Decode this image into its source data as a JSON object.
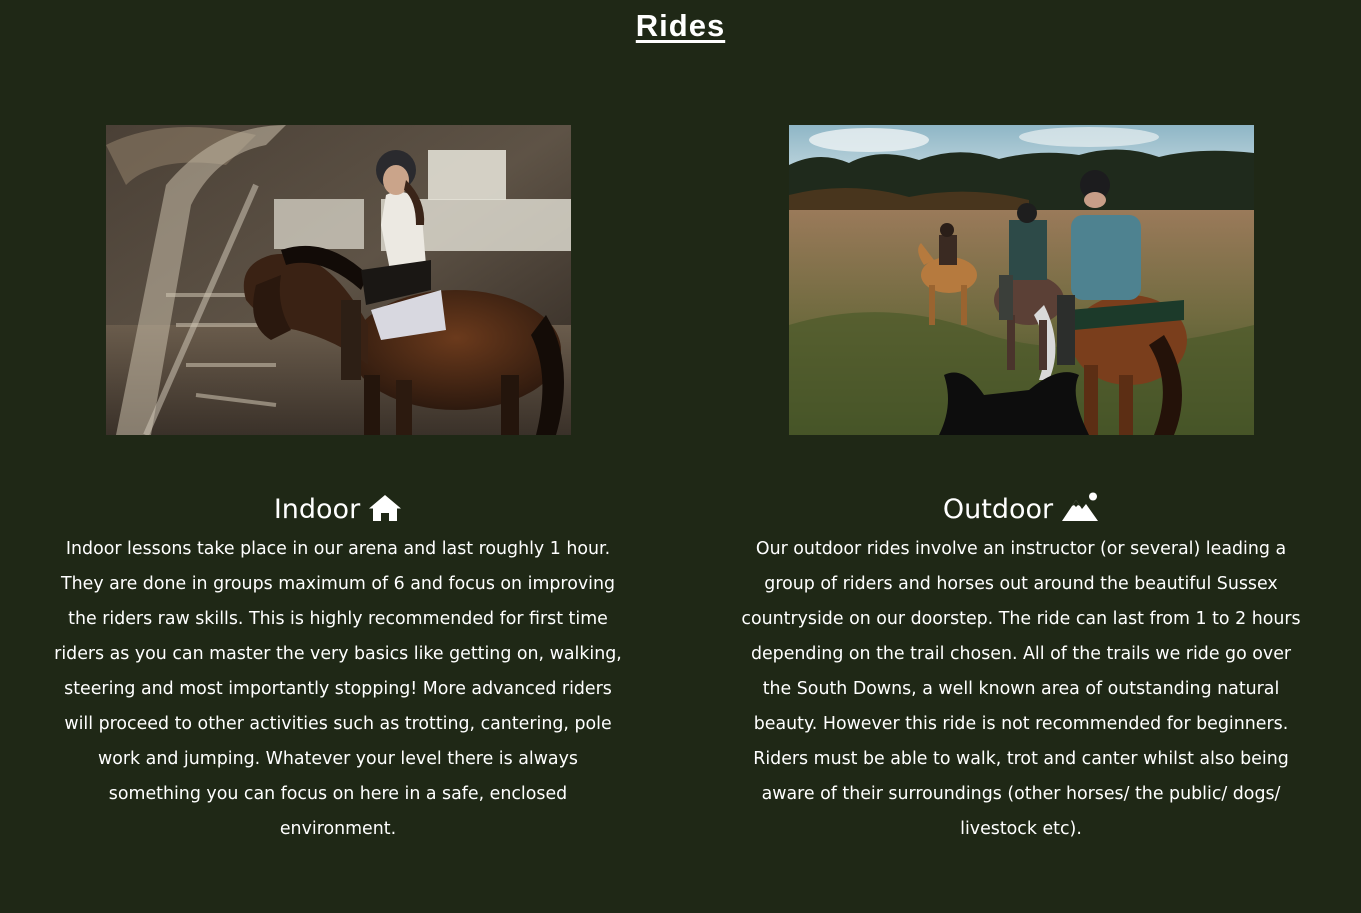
{
  "page": {
    "title": "Rides"
  },
  "rides": [
    {
      "heading": "Indoor",
      "icon": "house-icon",
      "description": "Indoor lessons take place in our arena and last roughly 1 hour. They are done in groups maximum of 6 and focus on improving the riders raw skills. This is highly recommended for first time riders as you can master the very basics like getting on, walking, steering and most importantly stopping! More advanced riders will proceed to other activities such as trotting, cantering, pole work and jumping. Whatever your level there is always something you can focus on here in a safe, enclosed environment."
    },
    {
      "heading": "Outdoor",
      "icon": "mountain-sun-icon",
      "description": "Our outdoor rides involve an instructor (or several) leading a group of riders and horses out around the beautiful Sussex countryside on our doorstep. The ride can last from 1 to 2 hours depending on the trail chosen. All of the trails we ride go over the South Downs, a well known area of outstanding natural beauty. However this ride is not recommended for beginners. Riders must be able to walk, trot and canter whilst also being aware of their surroundings (other horses/ the public/ dogs/ livestock etc)."
    }
  ],
  "colors": {
    "background": "#1f2816",
    "text": "#ffffff"
  }
}
